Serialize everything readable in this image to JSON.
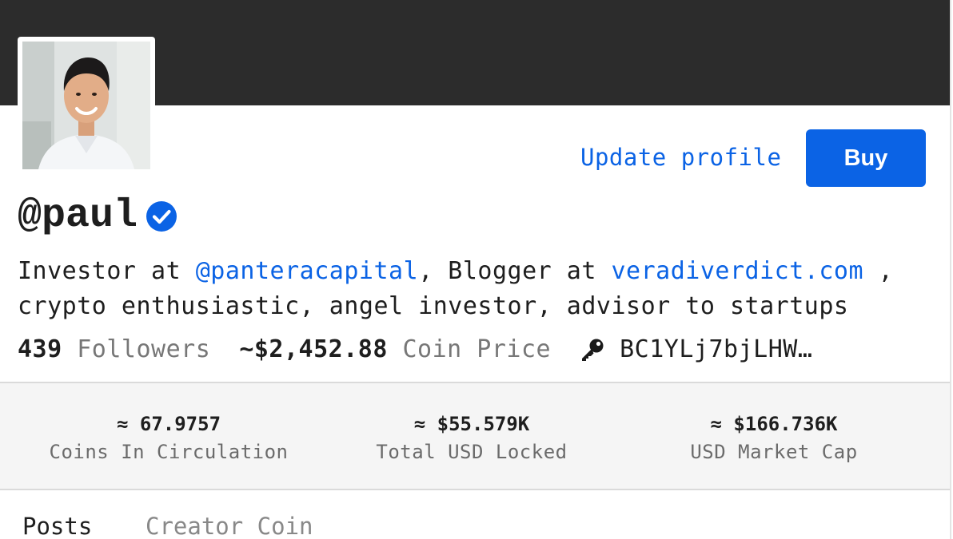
{
  "profile": {
    "update_label": "Update profile",
    "buy_label": "Buy",
    "username": "@paul",
    "bio_prefix": "Investor at ",
    "bio_mention": "@panteracapital",
    "bio_middle": ", Blogger at ",
    "bio_link": "veradiverdict.com",
    "bio_suffix": " ,\ncrypto enthusiastic, angel investor, advisor to startups",
    "followers_count": "439",
    "followers_label": "Followers",
    "coin_price": "~$2,452.88",
    "coin_price_label": "Coin Price",
    "public_key": "BC1YLj7bjLHW…"
  },
  "metrics": [
    {
      "value": "≈ 67.9757",
      "label": "Coins In Circulation"
    },
    {
      "value": "≈ $55.579K",
      "label": "Total USD Locked"
    },
    {
      "value": "≈ $166.736K",
      "label": "USD Market Cap"
    }
  ],
  "tabs": [
    {
      "label": "Posts",
      "active": true
    },
    {
      "label": "Creator Coin",
      "active": false
    }
  ],
  "icons": {
    "verified": "verified-check-icon",
    "key": "key-icon"
  },
  "colors": {
    "accent": "#0b63e5",
    "banner": "#2c2c2c",
    "metrics_bg": "#f5f5f5"
  }
}
